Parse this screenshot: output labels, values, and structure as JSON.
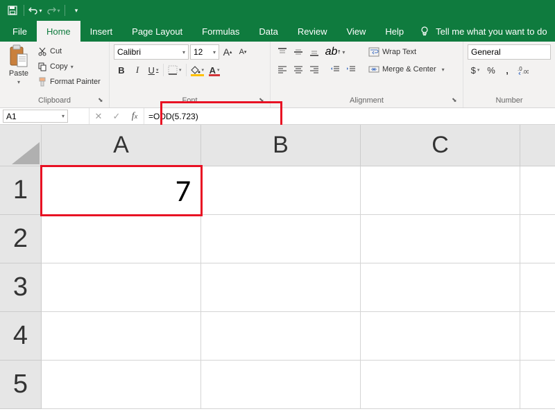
{
  "qat": {
    "save": "💾",
    "undo": "↶",
    "redo": "↷"
  },
  "tabs": {
    "file": "File",
    "home": "Home",
    "insert": "Insert",
    "page_layout": "Page Layout",
    "formulas": "Formulas",
    "data": "Data",
    "review": "Review",
    "view": "View",
    "help": "Help",
    "tell_me": "Tell me what you want to do"
  },
  "ribbon": {
    "clipboard": {
      "paste": "Paste",
      "cut": "Cut",
      "copy": "Copy",
      "format_painter": "Format Painter",
      "label": "Clipboard"
    },
    "font": {
      "name": "Calibri",
      "size": "12",
      "grow": "A",
      "shrink": "A",
      "bold": "B",
      "italic": "I",
      "underline": "U",
      "label": "Font"
    },
    "alignment": {
      "wrap": "Wrap Text",
      "merge": "Merge & Center",
      "label": "Alignment"
    },
    "number": {
      "format": "General",
      "currency": "$",
      "percent": "%",
      "comma": ",",
      "label": "Number"
    }
  },
  "formula_bar": {
    "name_box": "A1",
    "formula": "=ODD(5.723)"
  },
  "grid": {
    "cols": [
      "A",
      "B",
      "C"
    ],
    "rows": [
      "1",
      "2",
      "3",
      "4",
      "5"
    ],
    "a1": "7"
  },
  "colors": {
    "highlight_red": "#e81123",
    "font_red": "#d13438",
    "fill_yellow": "#ffc000"
  }
}
